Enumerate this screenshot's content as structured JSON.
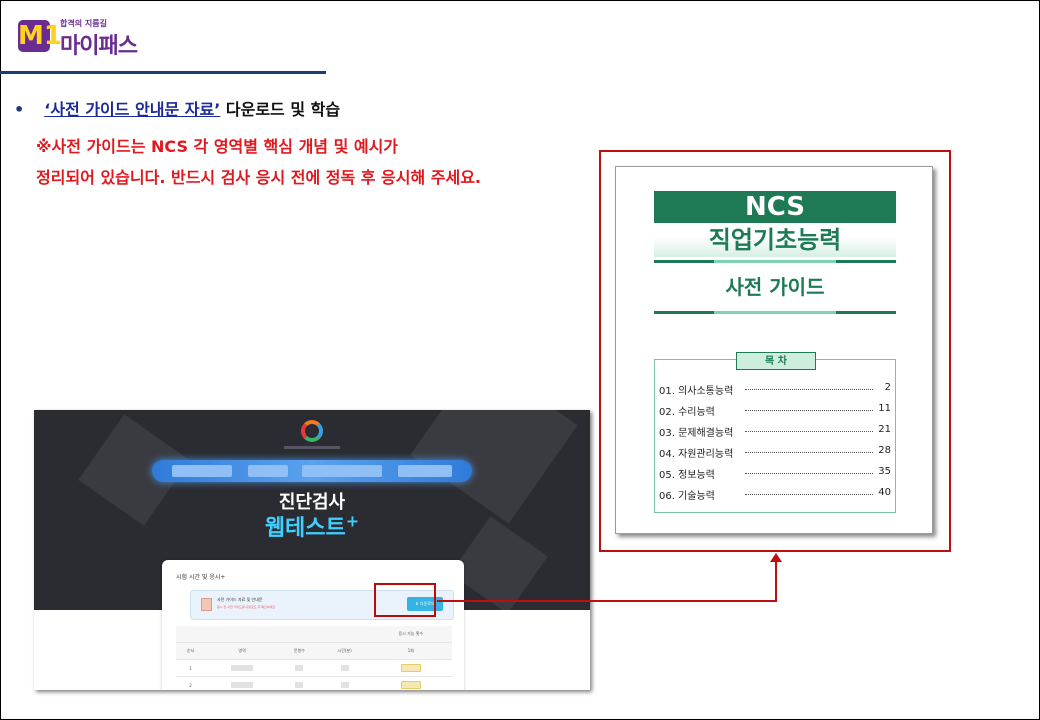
{
  "logo": {
    "tagline": "합격의 지름길",
    "name": "마이패스",
    "mark": "M1"
  },
  "headline": {
    "bullet": "•",
    "link_title": "‘사전 가이드 안내문 자료’",
    "rest": " 다운로드 및 학습"
  },
  "notes": [
    "※사전 가이드는 NCS 각 영역별 핵심 개념 및 예시가",
    "정리되어 있습니다. 반드시 검사 응시 전에 정독 후 응시해 주세요."
  ],
  "screenshot": {
    "title_line1": "진단검사",
    "title_line2": "웹테스트",
    "title_plus": "+",
    "card_heading": "시험 시간 및 응시+",
    "notice_title": "사전 가이드 자료 및 안내문",
    "notice_sub": "응시 전 사전 가이드를 다운로드 후 확인하세요",
    "download_label": "⬇ 다운로드",
    "table_group_header": "응시 가능 횟수",
    "table_headers": [
      "순서",
      "영역",
      "문항수",
      "시간(분)",
      "1회"
    ],
    "table_rows": [
      {
        "order": "1"
      },
      {
        "order": "2"
      }
    ]
  },
  "guide": {
    "ncs": "NCS",
    "subtitle": "직업기초능력",
    "guide_title": "사전 가이드",
    "toc_title": "목  차",
    "toc": [
      {
        "label": "01. 의사소통능력",
        "page": "2"
      },
      {
        "label": "02. 수리능력",
        "page": "11"
      },
      {
        "label": "03. 문제해결능력",
        "page": "21"
      },
      {
        "label": "04. 자원관리능력",
        "page": "28"
      },
      {
        "label": "05. 정보능력",
        "page": "35"
      },
      {
        "label": "06. 기술능력",
        "page": "40"
      }
    ]
  },
  "colors": {
    "brand": "#6a2c91",
    "accent_red": "#e0191e",
    "link_blue": "#1b2a9a",
    "guide_green": "#1d7a55",
    "highlight_red": "#c00e0e"
  }
}
